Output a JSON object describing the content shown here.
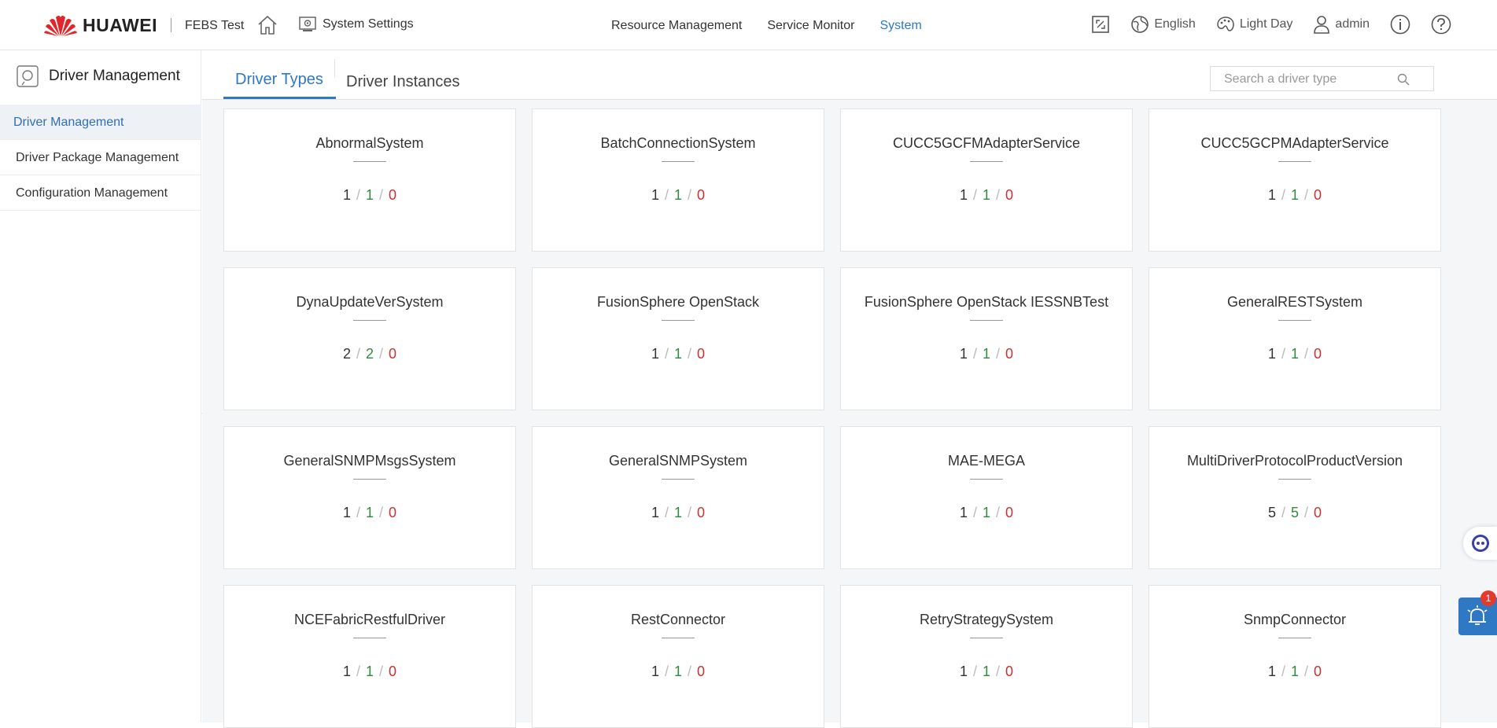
{
  "header": {
    "brand": "HUAWEI",
    "env": "FEBS Test",
    "system_settings": "System Settings",
    "nav": [
      "Resource Management",
      "Service Monitor",
      "System"
    ],
    "active_nav": "System",
    "language": "English",
    "theme": "Light Day",
    "user": "admin",
    "icons": [
      "huawei-logo",
      "home-icon",
      "settings-icon",
      "fullscreen-icon",
      "globe-icon",
      "theme-icon",
      "user-icon",
      "info-icon",
      "help-icon"
    ]
  },
  "sidebar": {
    "title": "Driver Management",
    "items": [
      "Driver Management",
      "Driver Package Management",
      "Configuration Management"
    ],
    "active": "Driver Management"
  },
  "tabs": {
    "items": [
      "Driver Types",
      "Driver Instances"
    ],
    "active": "Driver Types"
  },
  "search": {
    "placeholder": "Search a driver type"
  },
  "cards": [
    {
      "name": "AbnormalSystem",
      "total": "1",
      "ok": "1",
      "err": "0"
    },
    {
      "name": "BatchConnectionSystem",
      "total": "1",
      "ok": "1",
      "err": "0"
    },
    {
      "name": "CUCC5GCFMAdapterService",
      "total": "1",
      "ok": "1",
      "err": "0"
    },
    {
      "name": "CUCC5GCPMAdapterService",
      "total": "1",
      "ok": "1",
      "err": "0"
    },
    {
      "name": "DynaUpdateVerSystem",
      "total": "2",
      "ok": "2",
      "err": "0"
    },
    {
      "name": "FusionSphere OpenStack",
      "total": "1",
      "ok": "1",
      "err": "0"
    },
    {
      "name": "FusionSphere OpenStack IESSNBTest",
      "total": "1",
      "ok": "1",
      "err": "0"
    },
    {
      "name": "GeneralRESTSystem",
      "total": "1",
      "ok": "1",
      "err": "0"
    },
    {
      "name": "GeneralSNMPMsgsSystem",
      "total": "1",
      "ok": "1",
      "err": "0"
    },
    {
      "name": "GeneralSNMPSystem",
      "total": "1",
      "ok": "1",
      "err": "0"
    },
    {
      "name": "MAE-MEGA",
      "total": "1",
      "ok": "1",
      "err": "0"
    },
    {
      "name": "MultiDriverProtocolProductVersion",
      "total": "5",
      "ok": "5",
      "err": "0"
    },
    {
      "name": "NCEFabricRestfulDriver",
      "total": "1",
      "ok": "1",
      "err": "0"
    },
    {
      "name": "RestConnector",
      "total": "1",
      "ok": "1",
      "err": "0"
    },
    {
      "name": "RetryStrategySystem",
      "total": "1",
      "ok": "1",
      "err": "0"
    },
    {
      "name": "SnmpConnector",
      "total": "1",
      "ok": "1",
      "err": "0"
    }
  ],
  "floating": {
    "alarm_badge": "1",
    "icons": [
      "assistant-robot-icon",
      "alarm-bell-icon"
    ]
  },
  "colors": {
    "accent": "#2f78c4",
    "ok": "#2e8b3e",
    "err": "#d1302f",
    "brand_red": "#e0262b"
  }
}
